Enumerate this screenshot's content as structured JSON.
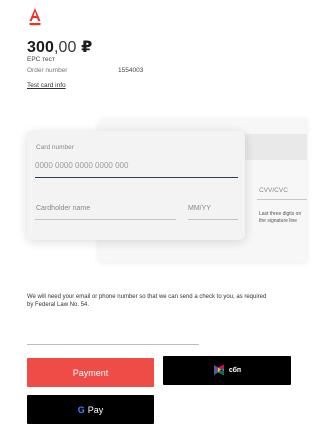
{
  "header": {
    "logo_icon": "alfa-bank-logo",
    "brand_color": "#ef3124"
  },
  "summary": {
    "amount_int": "300",
    "amount_dec": ",00",
    "currency": "₽",
    "merchant": "ЕРС тест",
    "order_label": "Order number",
    "order_number": "1554003",
    "test_card_link": "Test card info"
  },
  "card": {
    "number_label": "Card number",
    "number_placeholder": "0000 0000 0000 0000 000",
    "number_value": "",
    "holder_label": "Cardholder name",
    "expiry_label": "MM/YY",
    "cvv_label": "CVV/CVC",
    "cvv_hint": "Last three digits on the signature line"
  },
  "notice": "We will need your email or phone number so that we can send a check to you, as required by Federal Law No. 54.",
  "buttons": {
    "payment_label": "Payment",
    "sbp_label": "сбп",
    "sbp_icon": "sbp-logo-icon",
    "gpay_g": "G",
    "gpay_label": "Pay",
    "payment_color": "#ef4b47"
  }
}
